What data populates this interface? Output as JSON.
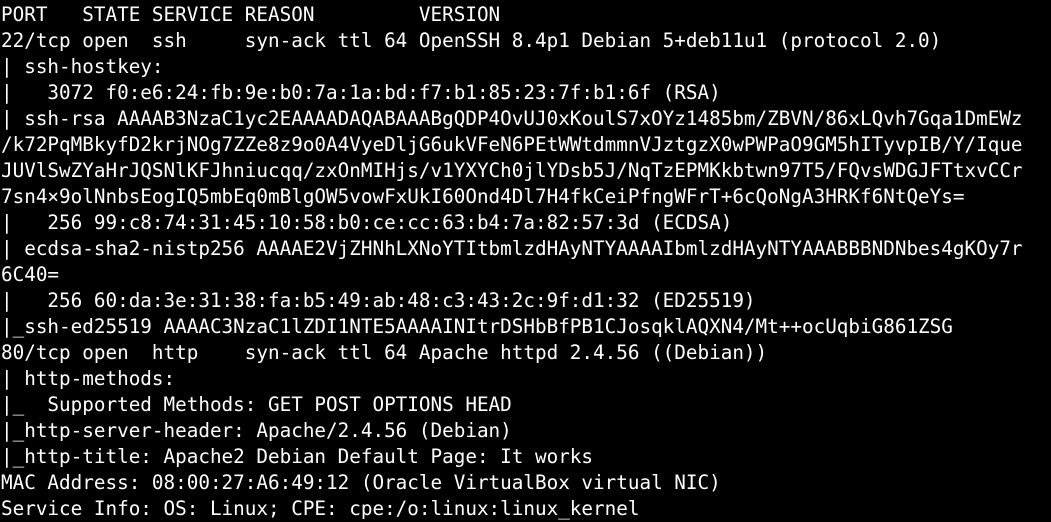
{
  "terminal": {
    "lines": [
      "PORT   STATE SERVICE REASON         VERSION",
      "22/tcp open  ssh     syn-ack ttl 64 OpenSSH 8.4p1 Debian 5+deb11u1 (protocol 2.0)",
      "| ssh-hostkey: ",
      "|   3072 f0:e6:24:fb:9e:b0:7a:1a:bd:f7:b1:85:23:7f:b1:6f (RSA)",
      "| ssh-rsa AAAAB3NzaC1yc2EAAAADAQABAAABgQDP4OvUJ0xKoulS7xOYz1485bm/ZBVN/86xLQvh7Gqa1DmEWz",
      "/k72PqMBkyfD2krjNOg7ZZe8z9o0A4VyeDljG6ukVFeN6PEtWWtdmmnVJztgzX0wPWPaO9GM5hITyvpIB/Y/Ique",
      "JUVlSwZYaHrJQSNlKFJhniucqq/zxOnMIHjs/v1YXYCh0jlYDsb5J/NqTzEPMKkbtwn97T5/FQvsWDGJFTtxvCCr",
      "7sn4×9olNnbsEogIQ5mbEq0mBlgOW5vowFxUkI60Ond4Dl7H4fkCeiPfngWFrT+6cQoNgA3HRKf6NtQeYs=",
      "|   256 99:c8:74:31:45:10:58:b0:ce:cc:63:b4:7a:82:57:3d (ECDSA)",
      "| ecdsa-sha2-nistp256 AAAAE2VjZHNhLXNoYTItbmlzdHAyNTYAAAAIbmlzdHAyNTYAAABBBNDNbes4gKOy7r",
      "6C40=",
      "|   256 60:da:3e:31:38:fa:b5:49:ab:48:c3:43:2c:9f:d1:32 (ED25519)",
      "|_ssh-ed25519 AAAAC3NzaC1lZDI1NTE5AAAAINItrDSHbBfPB1CJosqklAQXN4/Mt++ocUqbiG861ZSG",
      "80/tcp open  http    syn-ack ttl 64 Apache httpd 2.4.56 ((Debian))",
      "| http-methods: ",
      "|_  Supported Methods: GET POST OPTIONS HEAD",
      "|_http-server-header: Apache/2.4.56 (Debian)",
      "|_http-title: Apache2 Debian Default Page: It works",
      "MAC Address: 08:00:27:A6:49:12 (Oracle VirtualBox virtual NIC)",
      "Service Info: OS: Linux; CPE: cpe:/o:linux:linux_kernel"
    ]
  }
}
